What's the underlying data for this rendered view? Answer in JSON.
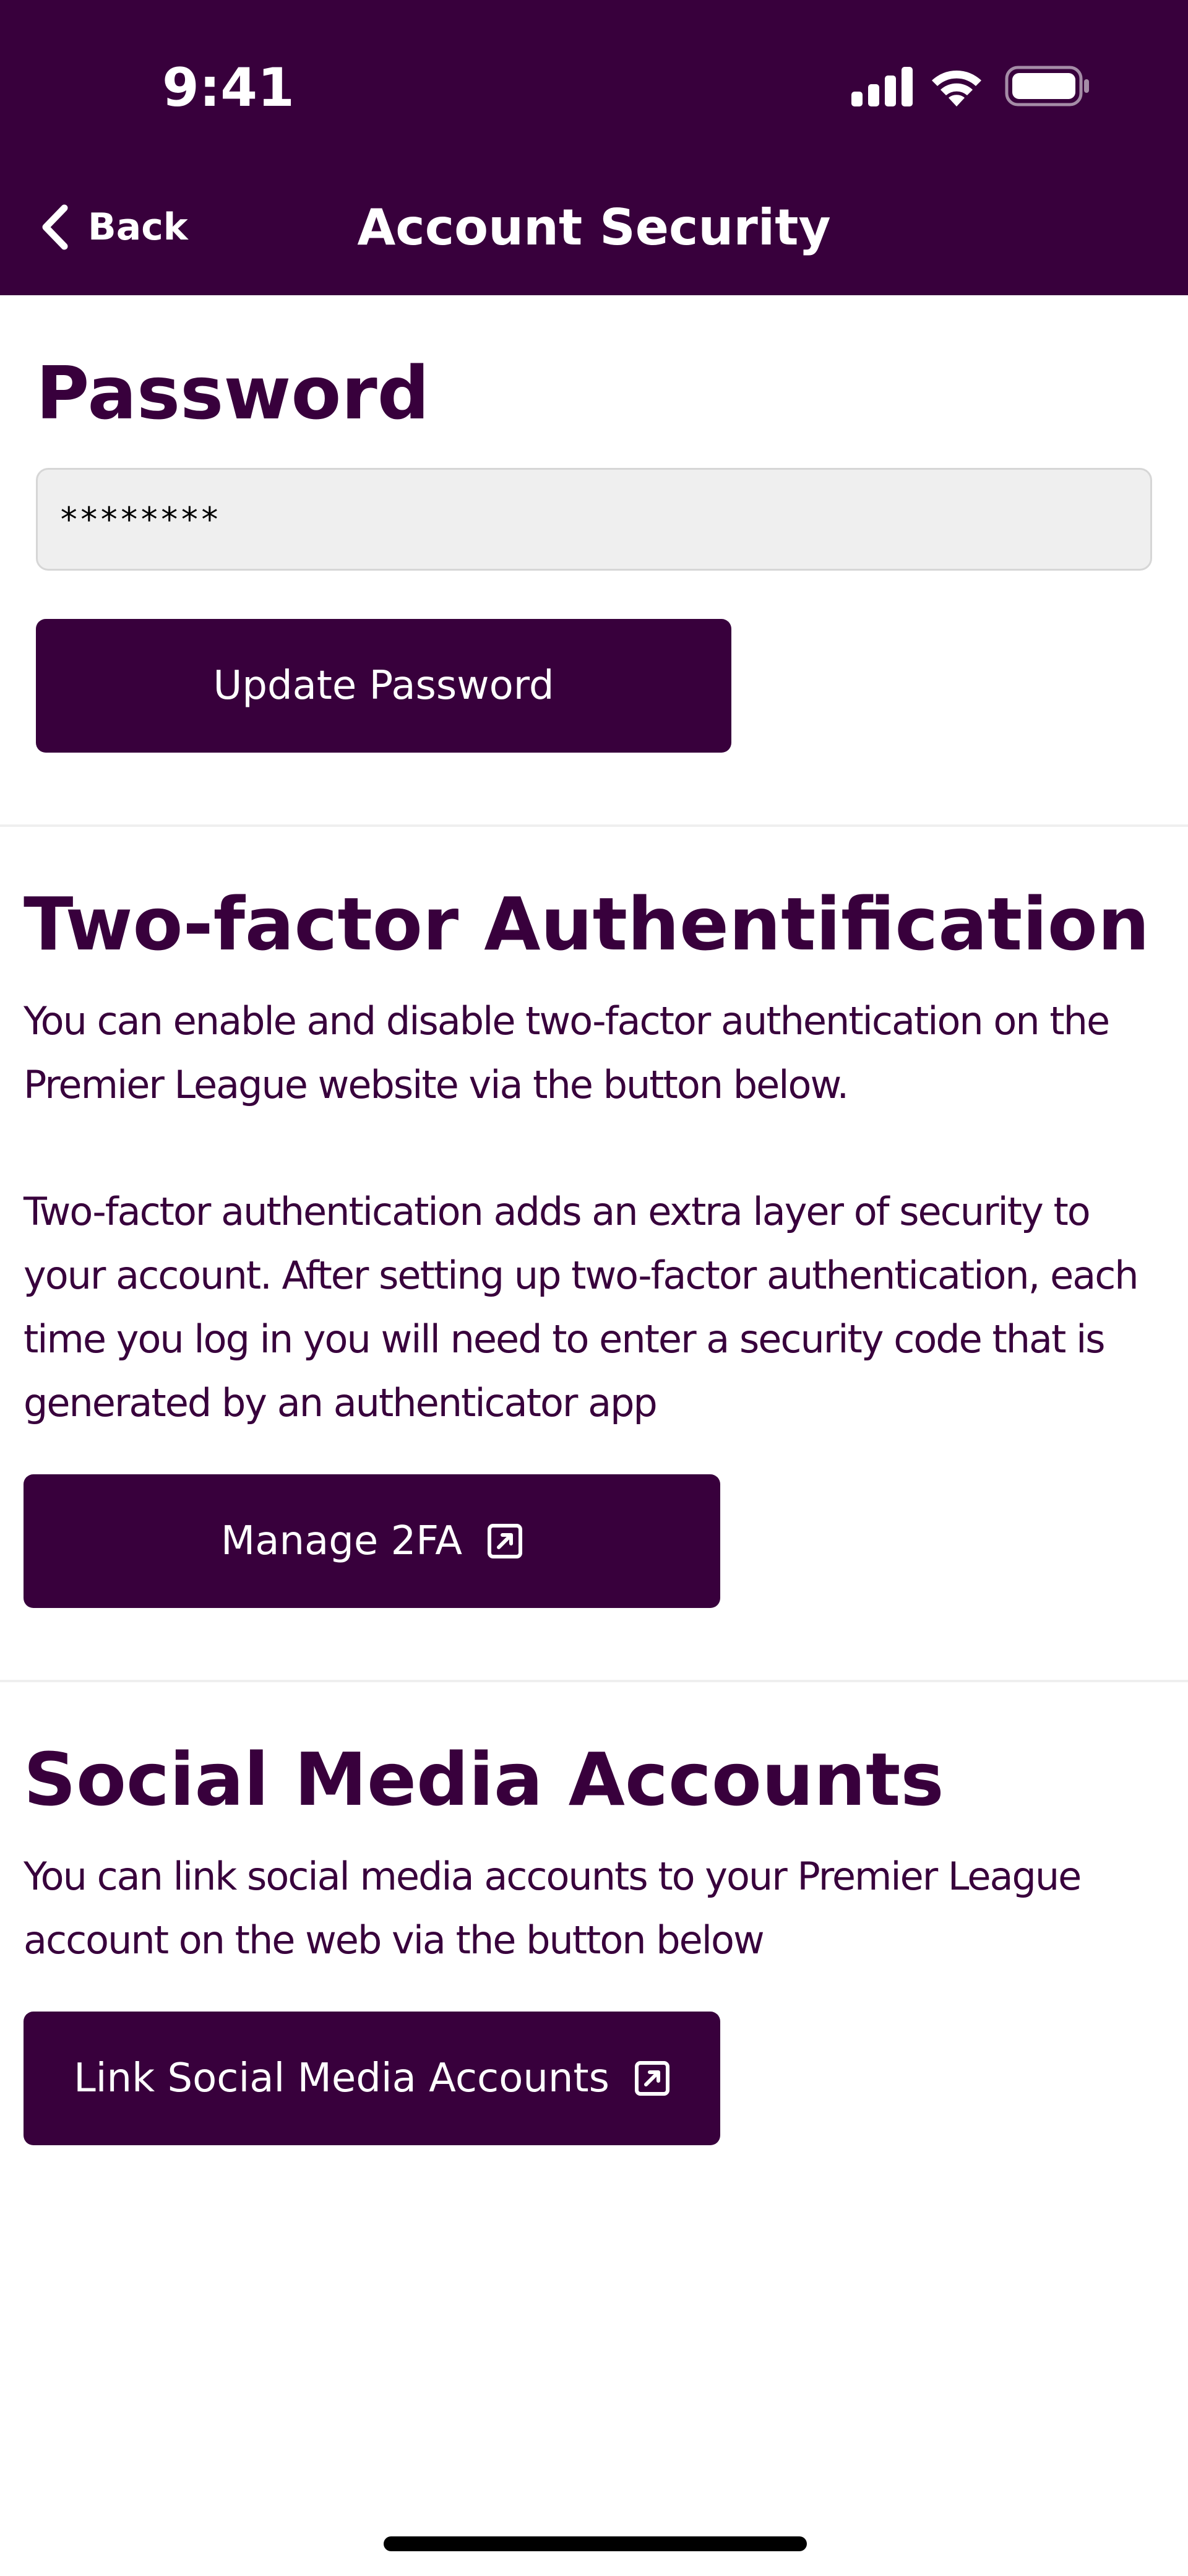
{
  "status_bar": {
    "time": "9:41"
  },
  "nav": {
    "back_label": "Back",
    "title": "Account Security"
  },
  "password_section": {
    "heading": "Password",
    "field_value": "********",
    "button_label": "Update Password"
  },
  "twofa_section": {
    "heading": "Two-factor Authentification",
    "paragraph_1": "You can enable and disable two-factor authentication on the Premier League website via the button below.",
    "paragraph_2": "Two-factor authentication adds an extra layer of security to your account. After setting up two-factor authentication, each time you log in you will need to enter a security code that is generated by an authenticator app",
    "button_label": "Manage 2FA",
    "button_icon": "external-link-icon"
  },
  "social_section": {
    "heading": "Social Media Accounts",
    "paragraph": "You can link social media accounts to your Premier League account on the web via the button below",
    "button_label": "Link Social Media Accounts",
    "button_icon": "external-link-icon"
  },
  "colors": {
    "brand_purple": "#38003c",
    "field_background": "#efefef",
    "divider": "#efefef"
  }
}
